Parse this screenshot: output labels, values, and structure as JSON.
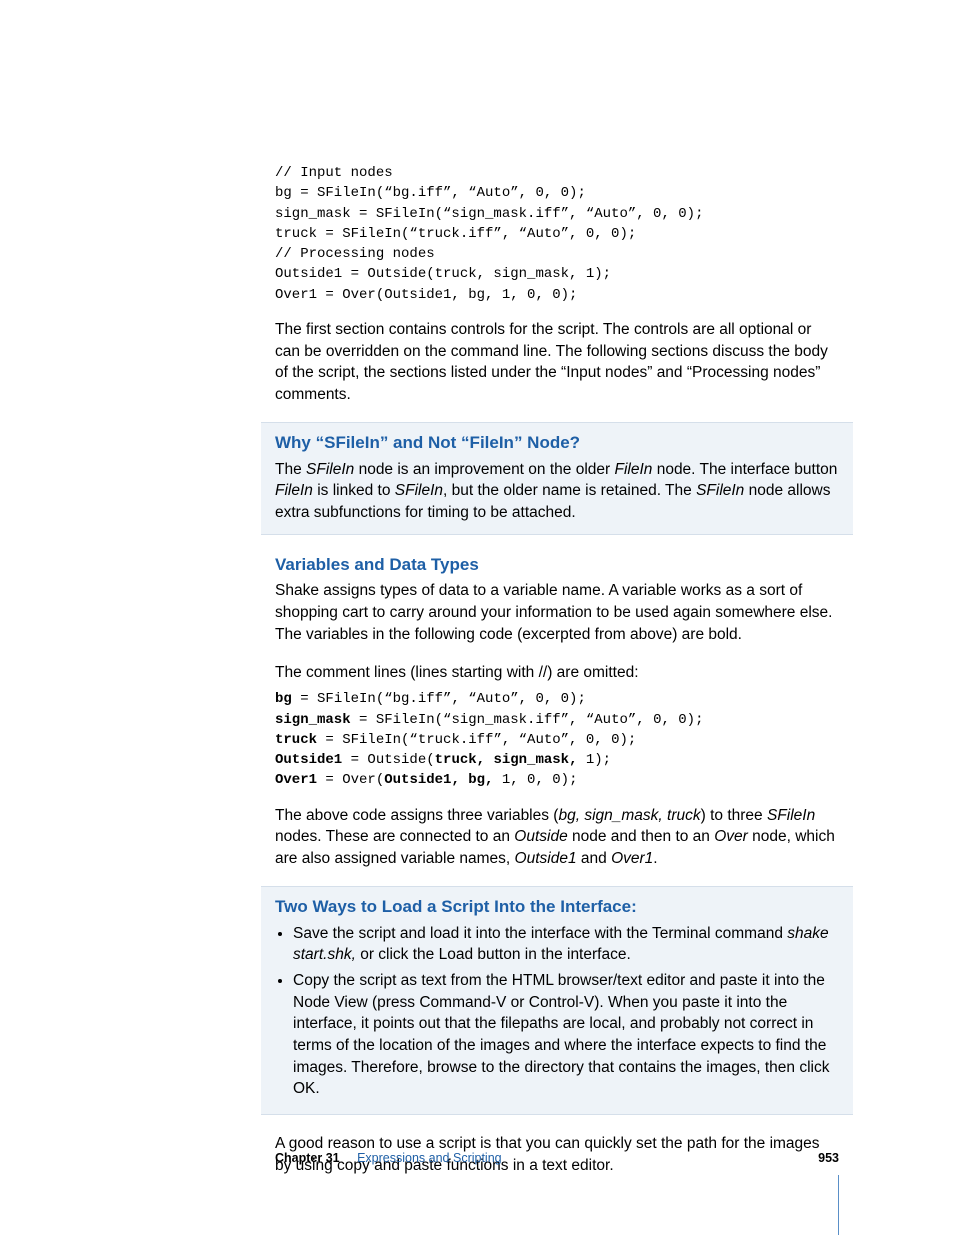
{
  "code1": "// Input nodes\nbg = SFileIn(“bg.iff”, “Auto”, 0, 0);\nsign_mask = SFileIn(“sign_mask.iff”, “Auto”, 0, 0);\ntruck = SFileIn(“truck.iff”, “Auto”, 0, 0);\n// Processing nodes\nOutside1 = Outside(truck, sign_mask, 1);\nOver1 = Over(Outside1, bg, 1, 0, 0);",
  "p1": "The first section contains controls for the script. The controls are all optional or can be overridden on the command line. The following sections discuss the body of the script, the sections listed under the “Input nodes” and “Processing nodes” comments.",
  "sb1": {
    "heading": "Why “SFileIn” and Not “FileIn” Node?",
    "t1": "The ",
    "i1": "SFileIn",
    "t2": " node is an improvement on the older ",
    "i2": "FileIn",
    "t3": " node. The interface button ",
    "i3": "FileIn",
    "t4": " is linked to ",
    "i4": "SFileIn",
    "t5": ", but the older name is retained. The ",
    "i5": "SFileIn",
    "t6": " node allows extra subfunctions for timing to be attached."
  },
  "h2": "Variables and Data Types",
  "p2": "Shake assigns types of data to a variable name. A variable works as a sort of shopping cart to carry around your information to be used again somewhere else. The variables in the following code (excerpted from above) are bold.",
  "p3": "The comment lines (lines starting with //) are omitted:",
  "code2": {
    "l1b": "bg",
    "l1r": " = SFileIn(“bg.iff”, “Auto”, 0, 0);",
    "l2b": "sign_mask",
    "l2r": " = SFileIn(“sign_mask.iff”, “Auto”, 0, 0);",
    "l3b": "truck",
    "l3r": " = SFileIn(“truck.iff”, “Auto”, 0, 0);",
    "l4b": "Outside1",
    "l4m": " = Outside(",
    "l4b2": "truck, sign_mask,",
    "l4r": " 1);",
    "l5b": "Over1",
    "l5m": " = Over(",
    "l5b2": "Outside1, bg,",
    "l5r": " 1, 0, 0);"
  },
  "p4": {
    "t1": "The above code assigns three variables (",
    "i1": "bg, sign_mask, truck",
    "t2": ") to three ",
    "i2": "SFileIn",
    "t3": " nodes. These are connected to an ",
    "i3": "Outside",
    "t4": " node and then to an ",
    "i4": "Over",
    "t5": " node, which are also assigned variable names, ",
    "i5": "Outside1",
    "t6": " and ",
    "i6": "Over1",
    "t7": "."
  },
  "sb2": {
    "heading": "Two Ways to Load a Script Into the Interface:",
    "li1a": "Save the script and load it into the interface with the Terminal command ",
    "li1i": "shake start.shk,",
    "li1b": " or click the Load button in the interface.",
    "li2": "Copy the script as text from the HTML browser/text editor and paste it into the Node View (press Command-V or Control-V). When you paste it into the interface, it points out that the filepaths are local, and probably not correct in terms of the location of the images and where the interface expects to find the images. Therefore, browse to the directory that contains the images, then click OK."
  },
  "p5": "A good reason to use a script is that you can quickly set the path for the images by using copy and paste functions in a text editor.",
  "footer": {
    "chapter_label": "Chapter 31",
    "chapter_title": "Expressions and Scripting",
    "page": "953"
  }
}
